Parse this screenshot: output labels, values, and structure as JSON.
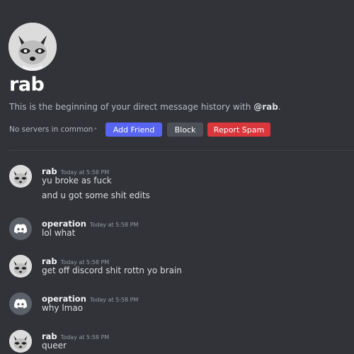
{
  "profile": {
    "username": "rab",
    "intro_prefix": "This is the beginning of your direct message history with ",
    "intro_mention": "@rab",
    "intro_suffix": ".",
    "servers_text": "No servers in common",
    "separator": "•",
    "add_friend_label": "Add Friend",
    "block_label": "Block",
    "report_spam_label": "Report Spam"
  },
  "colors": {
    "background": "#313338",
    "add_friend": "#5865f2",
    "block": "#4e5058",
    "report_spam": "#da373c"
  },
  "messages": [
    {
      "author": "rab",
      "avatar": "raccoon-avatar",
      "time": "Today at 5:58 PM",
      "lines": [
        "yu broke as fuck",
        "and u got some shit edits"
      ]
    },
    {
      "author": "operation",
      "avatar": "discord-default-avatar",
      "time": "Today at 5:58 PM",
      "lines": [
        "lol what"
      ]
    },
    {
      "author": "rab",
      "avatar": "raccoon-avatar",
      "time": "Today at 5:58 PM",
      "lines": [
        "get off discord shit rottn yo brain"
      ]
    },
    {
      "author": "operation",
      "avatar": "discord-default-avatar",
      "time": "Today at 5:58 PM",
      "lines": [
        "why lmao"
      ]
    },
    {
      "author": "rab",
      "avatar": "raccoon-avatar",
      "time": "Today at 5:58 PM",
      "lines": [
        "queer"
      ]
    }
  ]
}
